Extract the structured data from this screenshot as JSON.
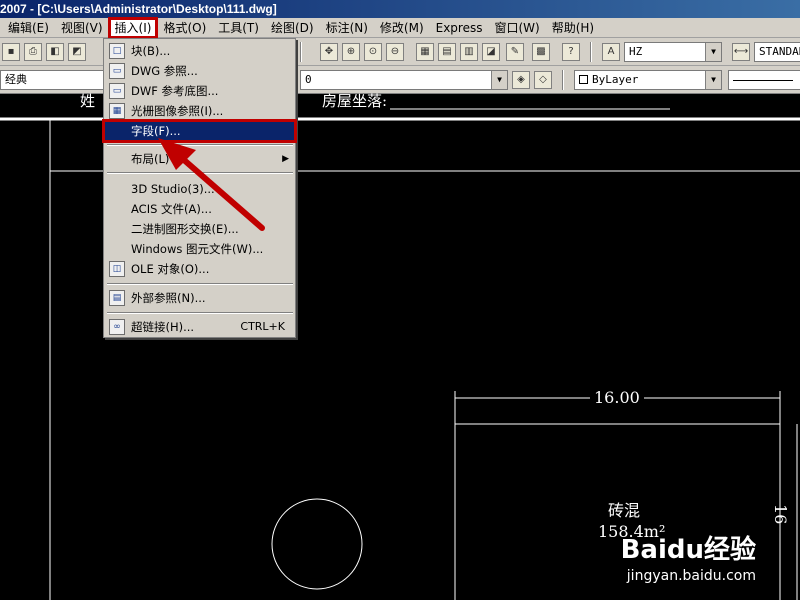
{
  "titlebar": {
    "text": "2007 - [C:\\Users\\Administrator\\Desktop\\111.dwg]"
  },
  "menubar": [
    {
      "label": "编辑(E)"
    },
    {
      "label": "视图(V)"
    },
    {
      "label": "插入(I)"
    },
    {
      "label": "格式(O)"
    },
    {
      "label": "工具(T)"
    },
    {
      "label": "绘图(D)"
    },
    {
      "label": "标注(N)"
    },
    {
      "label": "修改(M)"
    },
    {
      "label": "Express"
    },
    {
      "label": "窗口(W)"
    },
    {
      "label": "帮助(H)"
    }
  ],
  "toolbar": {
    "text_style": "HZ",
    "dim_style": "STANDAR",
    "workspace": "经典",
    "layer_value": "0",
    "color": "ByLayer"
  },
  "insert_menu": {
    "items": [
      {
        "label": "块(B)...",
        "icon": "block-icon"
      },
      {
        "label": "DWG 参照...",
        "icon": "dwg-xref-icon"
      },
      {
        "label": "DWF 参考底图...",
        "icon": "dwf-underlay-icon"
      },
      {
        "label": "光栅图像参照(I)...",
        "icon": "raster-image-icon"
      },
      {
        "label": "字段(F)..."
      },
      {
        "label": "布局(L)",
        "submenu": "▶"
      },
      {
        "label": "3D Studio(3)..."
      },
      {
        "label": "ACIS 文件(A)..."
      },
      {
        "label": "二进制图形交换(E)..."
      },
      {
        "label": "Windows 图元文件(W)..."
      },
      {
        "label": "OLE 对象(O)...",
        "icon": "ole-object-icon"
      },
      {
        "label": "外部参照(N)...",
        "icon": "xref-manager-icon"
      },
      {
        "label": "超链接(H)...",
        "icon": "hyperlink-icon",
        "shortcut": "CTRL+K"
      }
    ]
  },
  "drawing": {
    "partial_label_left": "姓",
    "partial_label_mid": "房屋坐落:",
    "dimension": "16.00",
    "room_name": "砖混",
    "room_area": "158.4m²",
    "right_dim_partial": "16"
  },
  "watermark": {
    "brand": "Baidu经验",
    "url": "jingyan.baidu.com"
  }
}
